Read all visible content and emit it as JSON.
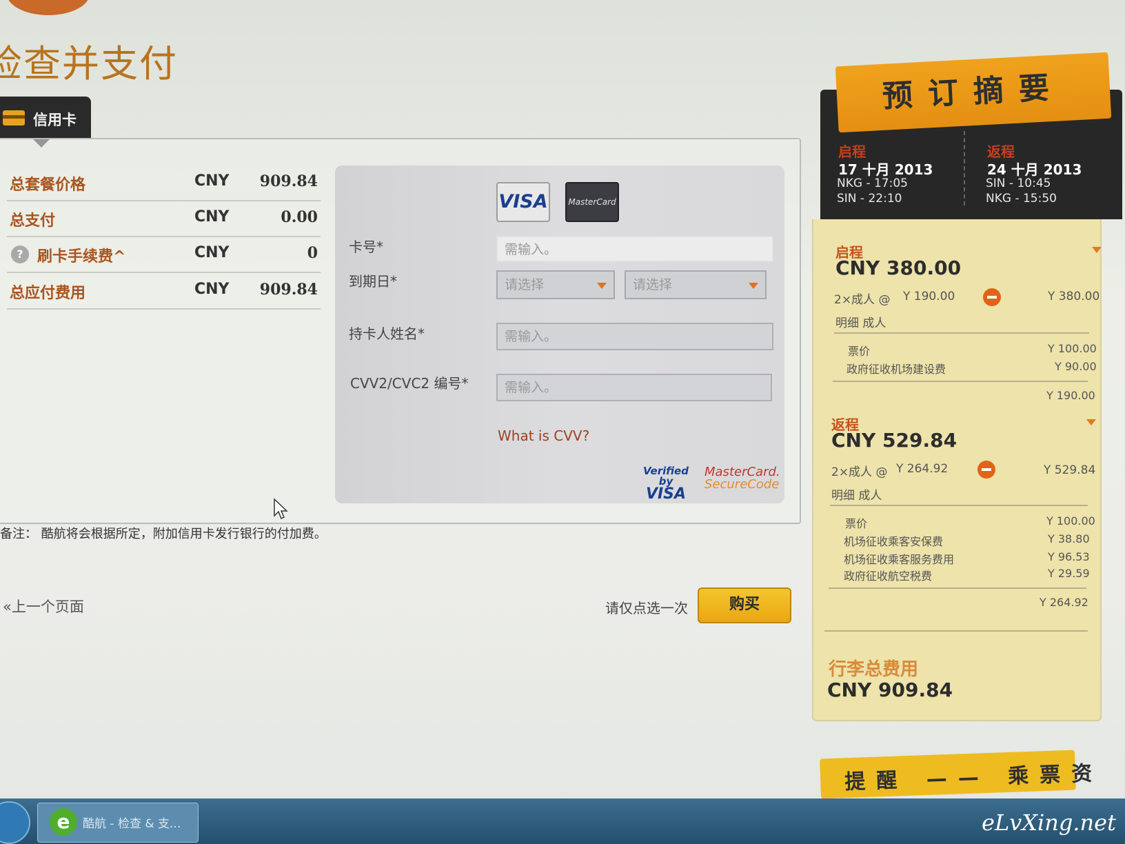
{
  "page": {
    "title": "检查并支付"
  },
  "tab": {
    "label": "信用卡"
  },
  "summary_rows": [
    {
      "label": "总套餐价格",
      "currency": "CNY",
      "value": "909.84"
    },
    {
      "label": "总支付",
      "currency": "CNY",
      "value": "0.00"
    },
    {
      "label": "刷卡手续费^",
      "currency": "CNY",
      "value": "0",
      "help_icon": "?"
    },
    {
      "label": "总应付费用",
      "currency": "CNY",
      "value": "909.84"
    }
  ],
  "form": {
    "brands": {
      "visa": "VISA",
      "mastercard": "MasterCard"
    },
    "card_number_label": "卡号*",
    "card_number_placeholder": "需输入。",
    "expiry_label": "到期日*",
    "expiry_month_value": "请选择",
    "expiry_year_value": "请选择",
    "holder_label": "持卡人姓名*",
    "holder_placeholder": "需输入。",
    "cvv_label": "CVV2/CVC2 编号*",
    "cvv_placeholder": "需输入。",
    "cvv_link": "What is CVV?",
    "verified_by": "Verified by",
    "verified_visa": "VISA",
    "mc_secure_1": "MasterCard.",
    "mc_secure_2": "SecureCode"
  },
  "note": "备注： 酷航将会根据所定，附加信用卡发行银行的付加费。",
  "footer": {
    "prev_link": "«上一个页面",
    "click_once": "请仅点选一次",
    "buy_button": "购买"
  },
  "booking_summary": {
    "banner": "预订摘要",
    "outbound": {
      "label": "启程",
      "date": "17 十月 2013",
      "dep": "NKG - 17:05",
      "arr": "SIN - 22:10"
    },
    "return": {
      "label": "返程",
      "date": "24 十月 2013",
      "dep": "SIN - 10:45",
      "arr": "NKG - 15:50"
    },
    "outbound_detail": {
      "label": "启程",
      "total": "CNY 380.00",
      "pax_line": "2×成人 @",
      "unit_price": "Y 190.00",
      "pax_total": "Y 380.00",
      "breakdown_label": "明细 成人",
      "items": [
        {
          "name": "票价",
          "amount": "Y 100.00"
        },
        {
          "name": "政府征收机场建设费",
          "amount": "Y 90.00"
        }
      ],
      "subtotal": "Y 190.00"
    },
    "return_detail": {
      "label": "返程",
      "total": "CNY 529.84",
      "pax_line": "2×成人 @",
      "unit_price": "Y 264.92",
      "pax_total": "Y 529.84",
      "breakdown_label": "明细 成人",
      "items": [
        {
          "name": "票价",
          "amount": "Y 100.00"
        },
        {
          "name": "机场征收乘客安保费",
          "amount": "Y 38.80"
        },
        {
          "name": "机场征收乘客服务费用",
          "amount": "Y 96.53"
        },
        {
          "name": "政府征收航空税费",
          "amount": "Y 29.59"
        }
      ],
      "subtotal": "Y 264.92"
    },
    "grand_label": "行李总费用",
    "grand_total": "CNY 909.84"
  },
  "reminder_banner": "提醒 —— 乘票资讯",
  "taskbar": {
    "item_label": "酷航 - 检查 & 支..."
  },
  "watermark": "eLvXing.net"
}
